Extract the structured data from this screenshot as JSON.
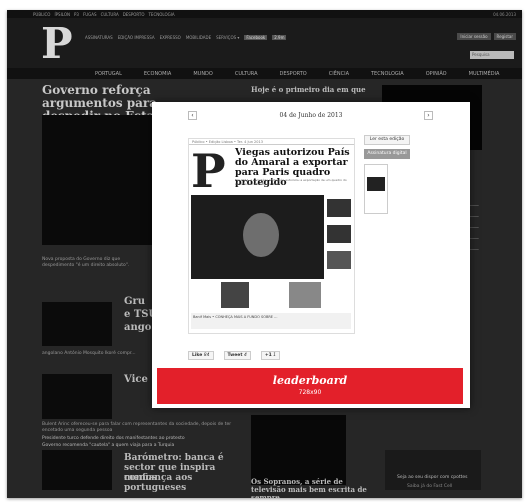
{
  "topbar": {
    "items": [
      "PÚBLICO",
      "ÍPSILON",
      "P3",
      "FUGAS",
      "CULTURA",
      "DESPORTO",
      "TECNOLOGIA"
    ],
    "date": "04.06.2013"
  },
  "masthead": {
    "logo": "P",
    "links": [
      "ASSINATURAS",
      "EDIÇÃO IMPRESSA",
      "EXPRESSO",
      "MOBILIDADE",
      "SERVIÇOS ▾"
    ],
    "facebook": "Facebook",
    "count": "2.9m",
    "login": "Iniciar sessão",
    "register": "Registar",
    "search_placeholder": "Pesquisa"
  },
  "nav": [
    "PORTUGAL",
    "ECONOMIA",
    "MUNDO",
    "CULTURA",
    "DESPORTO",
    "CIÊNCIA",
    "TECNOLOGIA",
    "OPINIÃO",
    "MULTIMÉDIA"
  ],
  "background": {
    "headline": "Governo reforça argumentos para despedir no Estado",
    "toptext": "Hoje é o primeiro dia em que",
    "caption": "Nova proposta do Governo diz que despedimento \"é um direito absoluto\".",
    "story2": "Gru",
    "story2b": "e TSU",
    "story2c": "ango",
    "caption2": "angolano António Mosquito Ikoré compr...",
    "story3": "Vice",
    "story4": "Barómetro: banca é sector que inspira menos",
    "story4b": "confiança aos portugueses",
    "story5": "Os Sopranos, a série de televisão mais bem escrita de sempre",
    "bullets": [
      "Presidente turco defende direito dos manifestantes ao protesto",
      "Governo recomenda \"cautela\" a quem viaja para a Turquia"
    ],
    "text3": "Bulent Arinc ofereceu-se para falar com representantes da sociedade, depois de ter encetado uma segunda pessoa",
    "ad": "Seja ao seu dispor com cpottes",
    "adsub": "Saiba já do Fast Cell"
  },
  "modal": {
    "date": "04 de Junho de 2013",
    "prev": "‹",
    "next": "›",
    "read_button": "Ler esta edição",
    "subscribe_button": "Assinatura digital",
    "cover": {
      "logo": "P",
      "top": "Público • Edição Lisboa • Ter. 4 Jun 2013",
      "title": "Viegas autorizou País do Amaral a exportar para Paris quadro protegido",
      "lead": "Em 2011, o secretário português autorizou a exportação de um quadro do património cultural para Paris",
      "ad_text": "Banif Mais • CONHEÇA MAIS A FUNDO SOBRE ..."
    },
    "social": {
      "like": "Like",
      "like_count": "84",
      "tweet": "Tweet",
      "tweet_count": "4",
      "gplus": "+1",
      "gplus_count": "1"
    },
    "leaderboard": "leaderboard",
    "leaderboard_size": "728x90"
  },
  "colors": {
    "accent": "#e3202a"
  }
}
